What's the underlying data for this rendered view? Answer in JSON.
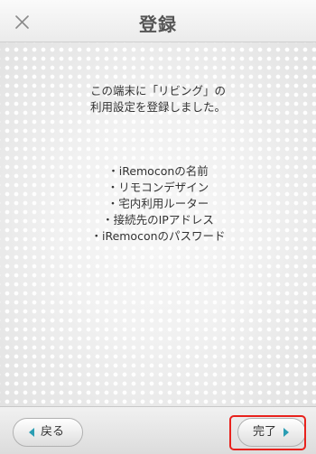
{
  "header": {
    "title": "登録",
    "close_icon": "close-icon"
  },
  "message": {
    "line1": "この端末に「リビング」の",
    "line2": "利用設定を登録しました。"
  },
  "items": [
    "・iRemoconの名前",
    "・リモコンデザイン",
    "・宅内利用ルーター",
    "・接続先のIPアドレス",
    "・iRemoconのパスワード"
  ],
  "footer": {
    "back_label": "戻る",
    "back_icon": "triangle-left-icon",
    "done_label": "完了",
    "done_icon": "triangle-right-icon"
  },
  "colors": {
    "accent": "#2a9db3",
    "highlight": "#e8221d",
    "title_text": "#555555"
  }
}
